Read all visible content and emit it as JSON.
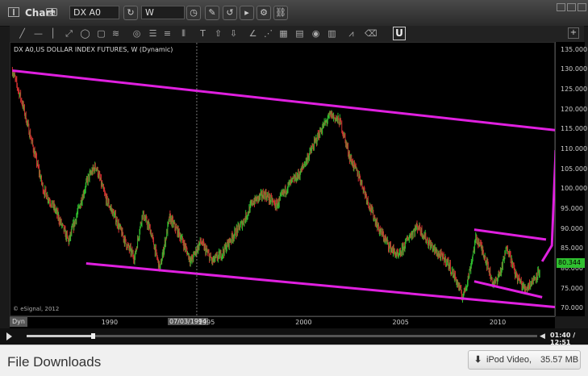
{
  "window": {
    "title": "Chart",
    "link_badge": "SH"
  },
  "toolbar": {
    "symbol": "DX A0",
    "interval": "W"
  },
  "chart": {
    "header": "DX A0,US DOLLAR INDEX FUTURES, W (Dynamic)",
    "copyright": "© eSignal, 2012",
    "dynamic_label": "Dyn",
    "cursor_date": "07/03/1994",
    "last_price": "80.344",
    "colors": {
      "background": "#000000",
      "up": "#2fbf2f",
      "down": "#d03030",
      "annotation": "#e020e0"
    }
  },
  "chart_data": {
    "type": "candlestick",
    "title": "DX A0,US DOLLAR INDEX FUTURES, W (Dynamic)",
    "ylim": [
      68,
      137
    ],
    "y_ticks": [
      "135.000",
      "130.000",
      "125.000",
      "120.000",
      "115.000",
      "110.000",
      "105.000",
      "100.000",
      "95.000",
      "90.000",
      "85.000",
      "80.000",
      "75.000",
      "70.000"
    ],
    "x_ticks": [
      "1990",
      "1995",
      "2000",
      "2005",
      "2010"
    ],
    "series": [
      {
        "values": [
          [
            1985.0,
            130
          ],
          [
            1985.5,
            122
          ],
          [
            1986.0,
            112
          ],
          [
            1986.6,
            100
          ],
          [
            1987.2,
            95
          ],
          [
            1987.9,
            87
          ],
          [
            1988.4,
            95
          ],
          [
            1988.9,
            103
          ],
          [
            1989.3,
            106
          ],
          [
            1989.8,
            98
          ],
          [
            1990.3,
            93
          ],
          [
            1990.9,
            86
          ],
          [
            1991.3,
            83
          ],
          [
            1991.7,
            94
          ],
          [
            1992.1,
            90
          ],
          [
            1992.6,
            80
          ],
          [
            1993.1,
            93
          ],
          [
            1993.7,
            88
          ],
          [
            1994.2,
            82
          ],
          [
            1994.7,
            87
          ],
          [
            1995.3,
            82
          ],
          [
            1995.8,
            84
          ],
          [
            1996.3,
            88
          ],
          [
            1996.9,
            92
          ],
          [
            1997.4,
            97
          ],
          [
            1998.0,
            99
          ],
          [
            1998.6,
            96
          ],
          [
            1999.2,
            101
          ],
          [
            1999.8,
            104
          ],
          [
            2000.4,
            110
          ],
          [
            2000.9,
            115
          ],
          [
            2001.4,
            119
          ],
          [
            2001.9,
            117
          ],
          [
            2002.4,
            108
          ],
          [
            2002.9,
            103
          ],
          [
            2003.4,
            96
          ],
          [
            2003.9,
            90
          ],
          [
            2004.4,
            86
          ],
          [
            2004.9,
            83
          ],
          [
            2005.4,
            88
          ],
          [
            2005.9,
            91
          ],
          [
            2006.4,
            87
          ],
          [
            2006.9,
            84
          ],
          [
            2007.4,
            82
          ],
          [
            2007.9,
            77
          ],
          [
            2008.2,
            73
          ],
          [
            2008.5,
            78
          ],
          [
            2008.9,
            88
          ],
          [
            2009.3,
            84
          ],
          [
            2009.8,
            76
          ],
          [
            2010.2,
            80
          ],
          [
            2010.5,
            86
          ],
          [
            2010.9,
            79
          ],
          [
            2011.4,
            75
          ],
          [
            2011.8,
            77
          ],
          [
            2012.2,
            80
          ]
        ]
      }
    ],
    "annotations": [
      {
        "type": "trendline",
        "points": [
          [
            1985.0,
            130.0
          ],
          [
            2013.0,
            115.0
          ]
        ]
      },
      {
        "type": "trendline",
        "points": [
          [
            1988.8,
            81.5
          ],
          [
            2013.0,
            70.5
          ]
        ]
      },
      {
        "type": "trendline",
        "points": [
          [
            2008.8,
            90.0
          ],
          [
            2012.5,
            87.5
          ]
        ]
      },
      {
        "type": "trendline",
        "points": [
          [
            2008.8,
            77.0
          ],
          [
            2012.3,
            73.0
          ]
        ]
      },
      {
        "type": "arrow",
        "points": [
          [
            2012.3,
            82.0
          ],
          [
            2012.8,
            86.0
          ],
          [
            2013.0,
            110.0
          ]
        ]
      }
    ]
  },
  "player": {
    "time": "01:40 / 12:51",
    "progress": 0.13
  },
  "downloads": {
    "title": "File Downloads",
    "item_label": "iPod Video,",
    "item_size": "35.57 MB"
  }
}
